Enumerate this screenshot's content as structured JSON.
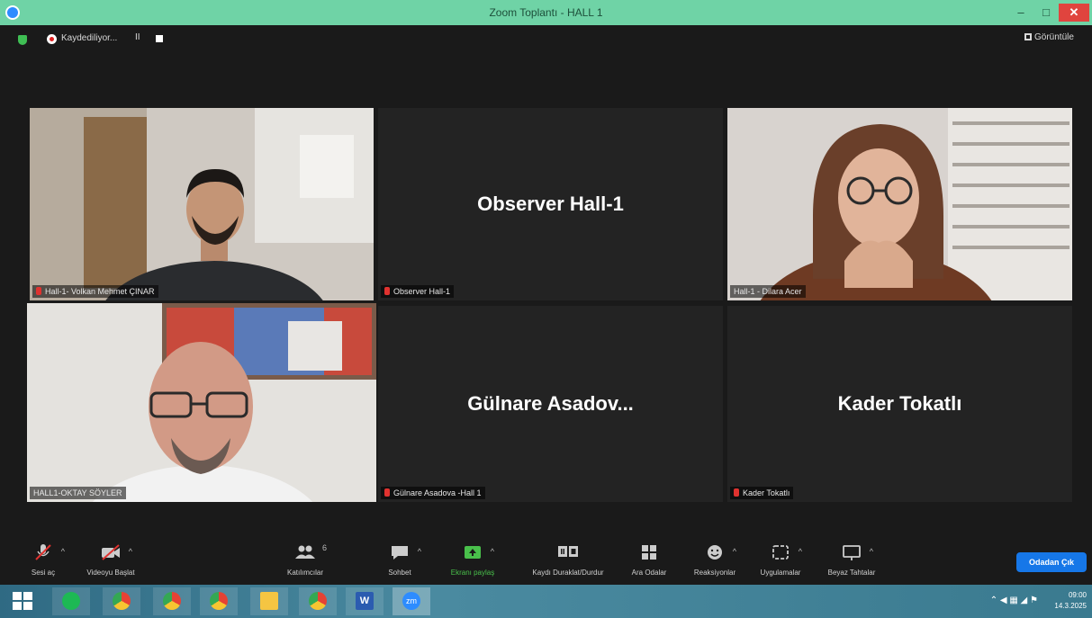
{
  "window": {
    "title": "Zoom Toplantı - HALL 1"
  },
  "topbar": {
    "recording_label": "Kaydediliyor...",
    "pause_symbol": "II",
    "view_label": "Görüntüle"
  },
  "tiles": [
    {
      "name_tag": "Hall-1- Volkan Mehmet ÇINAR",
      "big_name": "",
      "muted": true,
      "active": false
    },
    {
      "name_tag": "Observer Hall-1",
      "big_name": "Observer Hall-1",
      "muted": true,
      "active": false
    },
    {
      "name_tag": "Hall-1 - Dilara Acer",
      "big_name": "",
      "muted": false,
      "active": false
    },
    {
      "name_tag": "HALL1-OKTAY SÖYLER",
      "big_name": "",
      "muted": false,
      "active": true
    },
    {
      "name_tag": "Gülnare Asadova -Hall 1",
      "big_name": "Gülnare  Asadov...",
      "muted": true,
      "active": false
    },
    {
      "name_tag": "Kader Tokatlı",
      "big_name": "Kader Tokatlı",
      "muted": true,
      "active": false
    }
  ],
  "toolbar": {
    "audio": "Sesi aç",
    "video": "Videoyu Başlat",
    "participants": "Katılımcılar",
    "participants_count": "6",
    "chat": "Sohbet",
    "share": "Ekranı paylaş",
    "record": "Kaydı Duraklat/Durdur",
    "breakout": "Ara Odalar",
    "reactions": "Reaksiyonlar",
    "apps": "Uygulamalar",
    "whiteboard": "Beyaz Tahtalar",
    "end": "Odadan Çık"
  },
  "taskbar": {
    "time": "09:00",
    "date": "14.3.2025",
    "word_label": "W",
    "zoom_label": "zm"
  },
  "colors": {
    "titlebar": "#6fd3a6",
    "active_speaker": "#c8e04a",
    "share_green": "#49c04b",
    "end_blue": "#1677e8",
    "muted_red": "#e0322f"
  }
}
